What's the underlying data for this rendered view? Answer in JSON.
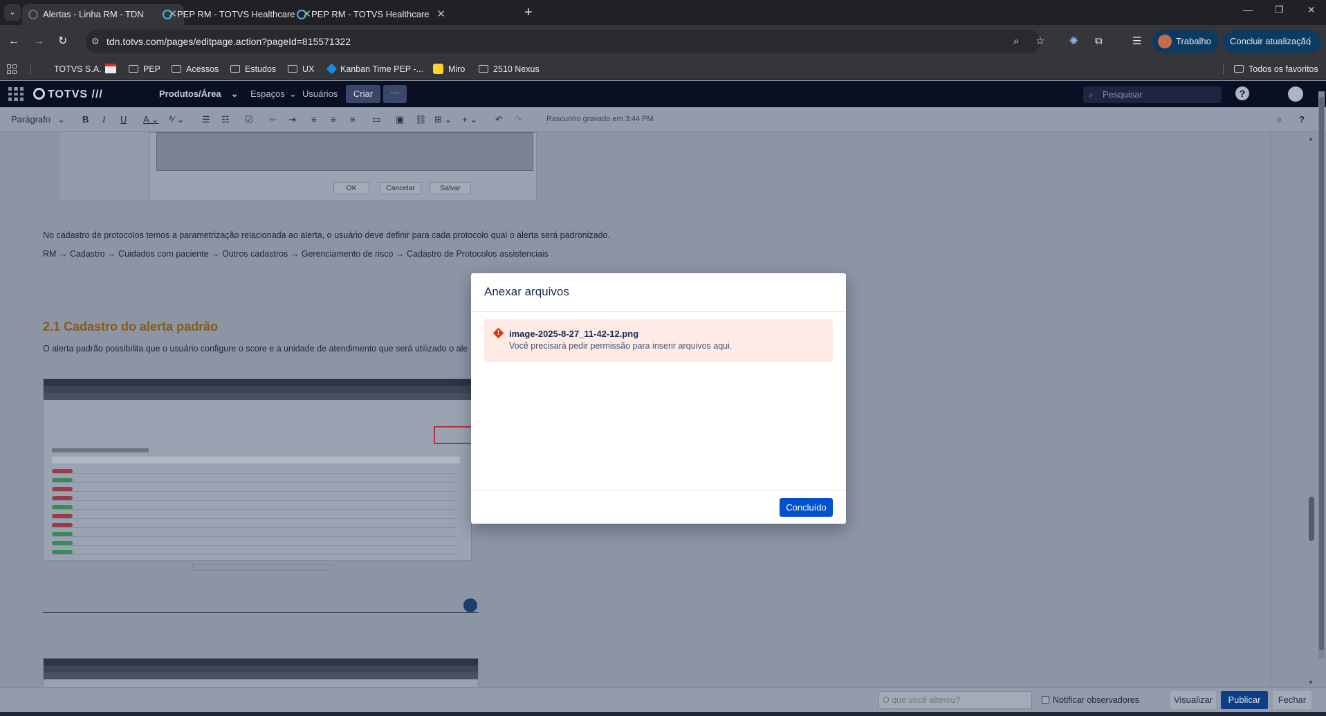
{
  "browser": {
    "tabs": [
      {
        "title": "Alertas - Linha RM - TDN",
        "active": true
      },
      {
        "title": "PEP RM - TOTVS Healthcare",
        "active": false
      },
      {
        "title": "PEP RM - TOTVS Healthcare",
        "active": false
      }
    ],
    "url": "tdn.totvs.com/pages/editpage.action?pageId=815571322",
    "profile_label": "Trabalho",
    "update_label": "Concluir atualização",
    "bookmarks": [
      "TOTVS S.A.",
      "PEP",
      "Acessos",
      "Estudos",
      "UX",
      "Kanban Time PEP -...",
      "Miro",
      "2510 Nexus"
    ],
    "all_bookmarks": "Todos os favoritos",
    "colors": {
      "tabbar": "#202124",
      "toolbar": "#35363a",
      "pill": "#0b3b63"
    }
  },
  "confluence": {
    "logo": "TOTVS ///",
    "nav": [
      "Produtos/Área",
      "Espaços",
      "Usuários"
    ],
    "create_label": "Criar",
    "more_label": "···",
    "search_placeholder": "Pesquisar",
    "help_label": "?"
  },
  "editor_toolbar": {
    "paragraph_style": "Parágrafo",
    "status": "Rascunho gravado em 3:44 PM",
    "help_label": "?"
  },
  "content": {
    "old_dialog_buttons": [
      "OK",
      "Cancelar",
      "Salvar"
    ],
    "paragraph1": "No cadastro de protocolos temos a parametrização relacionada ao alerta, o usuário deve definir para cada protocolo qual o alerta será padronizado.",
    "paragraph2": "RM → Cadastro → Cuidados com paciente → Outros cadastros → Gerenciamento de risco → Cadastro de Protocolos assistenciais",
    "heading": "2.1 Cadastro do alerta padrão",
    "paragraph3": "O alerta padrão possibilita que o usuário configure o score e a unidade de atendimento que será utilizado o ale"
  },
  "modal": {
    "title": "Anexar arquivos",
    "file_name": "image-2025-8-27_11-42-12.png",
    "error_message": "Você precisará pedir permissão para inserir arquivos aqui.",
    "done_label": "Concluído",
    "colors": {
      "primary": "#0052cc",
      "error_bg": "#ffebe6",
      "error_icon": "#de350b"
    }
  },
  "bottom_bar": {
    "comment_placeholder": "O que você alterou?",
    "notify_label": "Notificar observadores",
    "preview_label": "Visualizar",
    "publish_label": "Publicar",
    "close_label": "Fechar"
  }
}
